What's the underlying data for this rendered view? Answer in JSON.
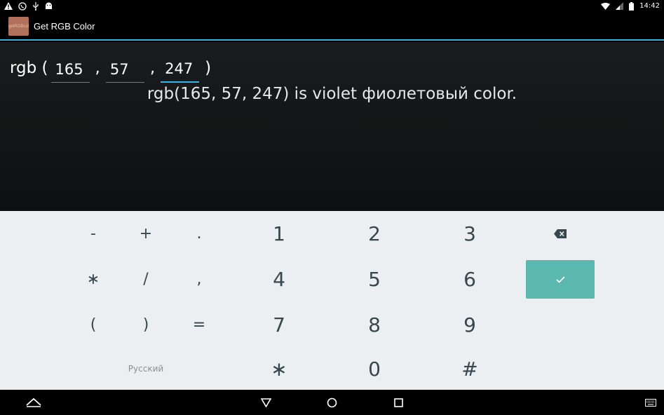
{
  "status_bar": {
    "time": "14:42",
    "icons_left": [
      "warning-icon",
      "viber-icon",
      "usb-icon",
      "android-icon"
    ],
    "icons_right": [
      "wifi-icon",
      "signal-icon",
      "battery-icon"
    ]
  },
  "app": {
    "icon_text": "getRGBcol",
    "title": "Get RGB Color"
  },
  "rgb_input": {
    "prefix": "rgb (",
    "separator": ",",
    "suffix": ")",
    "red": "165",
    "green": "57",
    "blue": "247"
  },
  "result_text": "rgb(165, 57, 247) is violet фиолетовый color.",
  "keyboard": {
    "row1": [
      "-",
      "+",
      ".",
      "1",
      "2",
      "3"
    ],
    "row2": [
      "∗",
      "/",
      ",",
      "4",
      "5",
      "6"
    ],
    "row3": [
      "(",
      ")",
      "=",
      "7",
      "8",
      "9"
    ],
    "row4": [
      "∗",
      "0",
      "#"
    ],
    "language": "Русский",
    "accent_color": "#5bb8ae"
  },
  "nav_bar": {
    "buttons": [
      "up-icon",
      "back-icon",
      "home-icon",
      "recents-icon",
      "keyboard-icon"
    ]
  }
}
